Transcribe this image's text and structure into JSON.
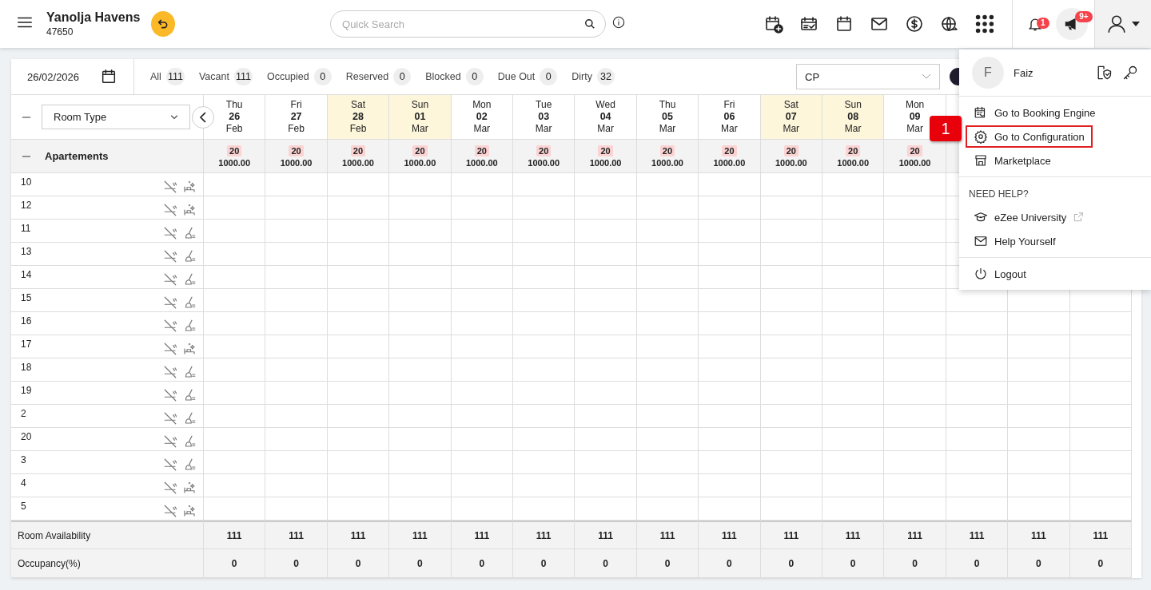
{
  "header": {
    "hotel_name": "Yanolja Havens",
    "hotel_id": "47650",
    "search": {
      "placeholder": "Quick Search"
    },
    "notifications": {
      "count": "1"
    },
    "announcements": {
      "count": "9+"
    }
  },
  "toolbar": {
    "date": "26/02/2026",
    "filters": [
      {
        "label": "All",
        "count": "111"
      },
      {
        "label": "Vacant",
        "count": "111"
      },
      {
        "label": "Occupied",
        "count": "0"
      },
      {
        "label": "Reserved",
        "count": "0"
      },
      {
        "label": "Blocked",
        "count": "0"
      },
      {
        "label": "Due Out",
        "count": "0"
      },
      {
        "label": "Dirty",
        "count": "32"
      }
    ],
    "rate_plan": {
      "value": "CP"
    }
  },
  "grid": {
    "room_type_select": {
      "value": "Room Type"
    },
    "dates": [
      {
        "weekday": "Thu",
        "day": "26",
        "month": "Feb",
        "weekend": false
      },
      {
        "weekday": "Fri",
        "day": "27",
        "month": "Feb",
        "weekend": false
      },
      {
        "weekday": "Sat",
        "day": "28",
        "month": "Feb",
        "weekend": true
      },
      {
        "weekday": "Sun",
        "day": "01",
        "month": "Mar",
        "weekend": true
      },
      {
        "weekday": "Mon",
        "day": "02",
        "month": "Mar",
        "weekend": false
      },
      {
        "weekday": "Tue",
        "day": "03",
        "month": "Mar",
        "weekend": false
      },
      {
        "weekday": "Wed",
        "day": "04",
        "month": "Mar",
        "weekend": false
      },
      {
        "weekday": "Thu",
        "day": "05",
        "month": "Mar",
        "weekend": false
      },
      {
        "weekday": "Fri",
        "day": "06",
        "month": "Mar",
        "weekend": false
      },
      {
        "weekday": "Sat",
        "day": "07",
        "month": "Mar",
        "weekend": true
      },
      {
        "weekday": "Sun",
        "day": "08",
        "month": "Mar",
        "weekend": true
      },
      {
        "weekday": "Mon",
        "day": "09",
        "month": "Mar",
        "weekend": false
      }
    ],
    "group": {
      "name": "Apartements",
      "rates": [
        {
          "available": "20",
          "price": "1000.00"
        },
        {
          "available": "20",
          "price": "1000.00"
        },
        {
          "available": "20",
          "price": "1000.00"
        },
        {
          "available": "20",
          "price": "1000.00"
        },
        {
          "available": "20",
          "price": "1000.00"
        },
        {
          "available": "20",
          "price": "1000.00"
        },
        {
          "available": "20",
          "price": "1000.00"
        },
        {
          "available": "20",
          "price": "1000.00"
        },
        {
          "available": "20",
          "price": "1000.00"
        },
        {
          "available": "20",
          "price": "1000.00"
        },
        {
          "available": "20",
          "price": "1000.00"
        },
        {
          "available": "20",
          "price": "1000.00"
        }
      ]
    },
    "rooms": [
      {
        "number": "10",
        "kind": "clean"
      },
      {
        "number": "12",
        "kind": "clean"
      },
      {
        "number": "11",
        "kind": "dirty"
      },
      {
        "number": "13",
        "kind": "dirty"
      },
      {
        "number": "14",
        "kind": "dirty"
      },
      {
        "number": "15",
        "kind": "dirty"
      },
      {
        "number": "16",
        "kind": "dirty"
      },
      {
        "number": "17",
        "kind": "clean"
      },
      {
        "number": "18",
        "kind": "dirty"
      },
      {
        "number": "19",
        "kind": "dirty"
      },
      {
        "number": "2",
        "kind": "dirty"
      },
      {
        "number": "20",
        "kind": "dirty"
      },
      {
        "number": "3",
        "kind": "dirty"
      },
      {
        "number": "4",
        "kind": "clean"
      },
      {
        "number": "5",
        "kind": "clean"
      }
    ],
    "summary": [
      {
        "label": "Room Availability",
        "values": [
          "111",
          "111",
          "111",
          "111",
          "111",
          "111",
          "111",
          "111",
          "111",
          "111",
          "111",
          "111",
          "111",
          "111",
          "111"
        ]
      },
      {
        "label": "Occupancy(%)",
        "values": [
          "0",
          "0",
          "0",
          "0",
          "0",
          "0",
          "0",
          "0",
          "0",
          "0",
          "0",
          "0",
          "0",
          "0",
          "0"
        ]
      }
    ]
  },
  "user_menu": {
    "avatar_initial": "F",
    "name": "Faiz",
    "groups": [
      {
        "items": [
          {
            "label": "Go to Booking Engine",
            "highlighted": false,
            "external": false
          },
          {
            "label": "Go to Configuration",
            "highlighted": true,
            "external": false
          },
          {
            "label": "Marketplace",
            "highlighted": false,
            "external": false
          }
        ]
      },
      {
        "heading": "NEED HELP?",
        "items": [
          {
            "label": "eZee University",
            "highlighted": false,
            "external": true
          },
          {
            "label": "Help Yourself",
            "highlighted": false,
            "external": false
          }
        ]
      },
      {
        "items": [
          {
            "label": "Logout",
            "highlighted": false,
            "external": false
          }
        ]
      }
    ]
  },
  "callout": {
    "label": "1"
  }
}
